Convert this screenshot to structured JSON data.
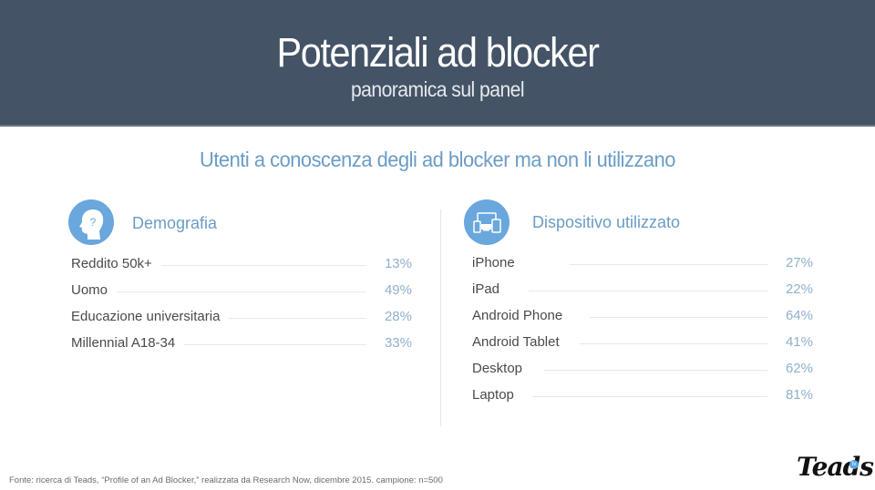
{
  "header": {
    "title": "Potenziali ad blocker",
    "subtitle": "panoramica sul panel"
  },
  "section_title": "Utenti a conoscenza degli ad blocker ma non li utilizzano",
  "demographics": {
    "heading": "Demografia",
    "icon": "head-question-icon",
    "rows": [
      {
        "label": "Reddito 50k+",
        "value": "13%"
      },
      {
        "label": "Uomo",
        "value": "49%"
      },
      {
        "label": "Educazione universitaria",
        "value": "28%"
      },
      {
        "label": "Millennial A18-34",
        "value": "33%"
      }
    ]
  },
  "devices": {
    "heading": "Dispositivo utilizzato",
    "icon": "devices-icon",
    "rows": [
      {
        "label": "iPhone",
        "value": "27%"
      },
      {
        "label": "iPad",
        "value": "22%"
      },
      {
        "label": "Android Phone",
        "value": "64%"
      },
      {
        "label": "Android Tablet",
        "value": "41%"
      },
      {
        "label": "Desktop",
        "value": "62%"
      },
      {
        "label": "Laptop",
        "value": "81%"
      }
    ]
  },
  "footer": {
    "source": "Fonte: ricerca di Teads, “Profile of an Ad Blocker,” realizzata da Research Now, dicembre 2015. campione: n=500"
  },
  "logo": {
    "text": "Teads",
    "badge": "tv"
  },
  "colors": {
    "header_bg": "#445366",
    "accent": "#6a9cc6",
    "icon_bg": "#6aa7dd",
    "value": "#8fb0cc"
  }
}
